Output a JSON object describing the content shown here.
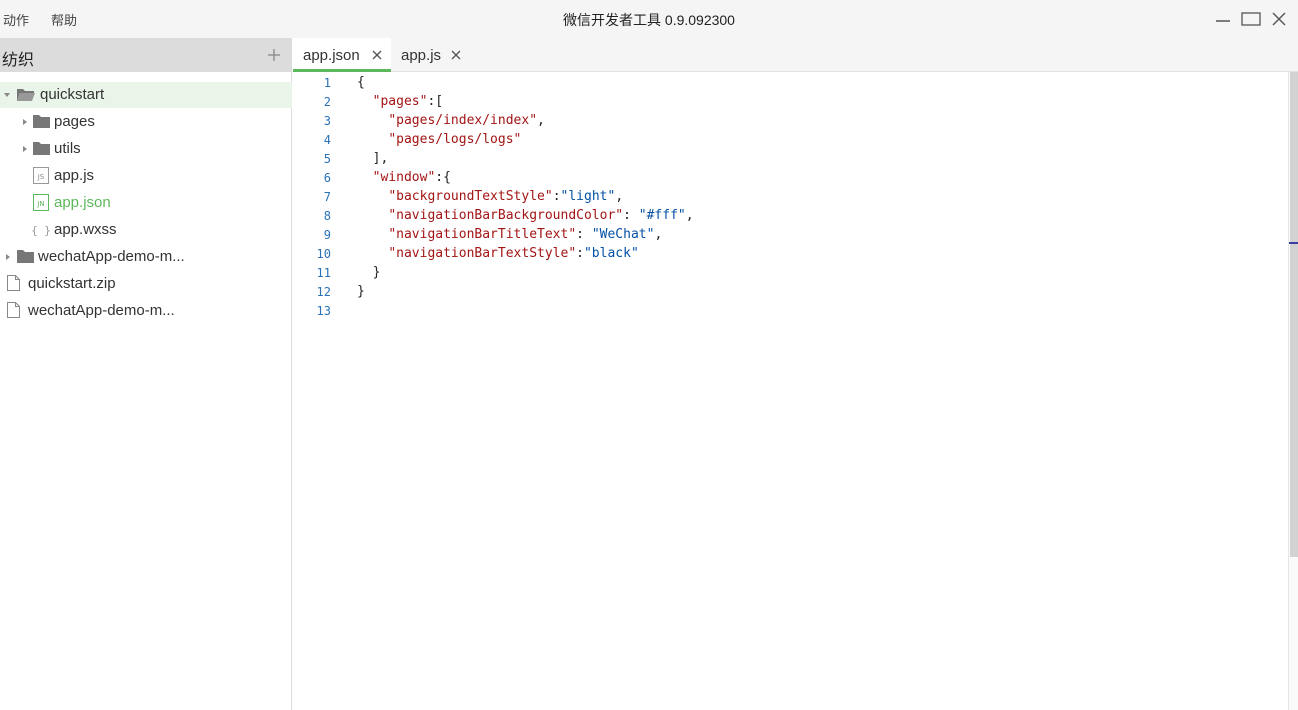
{
  "titlebar": {
    "menus": [
      "动作",
      "帮助"
    ],
    "title": "微信开发者工具 0.9.092300"
  },
  "sidebar": {
    "title": "纺织",
    "items": [
      {
        "label": "quickstart",
        "type": "folder-open",
        "depth": 0,
        "expanded": true,
        "selected": true
      },
      {
        "label": "pages",
        "type": "folder",
        "depth": 1,
        "expanded": false
      },
      {
        "label": "utils",
        "type": "folder",
        "depth": 1,
        "expanded": false
      },
      {
        "label": "app.js",
        "type": "js-file",
        "depth": 1,
        "badge": "JS"
      },
      {
        "label": "app.json",
        "type": "json-file",
        "depth": 1,
        "badge": "JN",
        "active": true
      },
      {
        "label": "app.wxss",
        "type": "wxss-file",
        "depth": 1,
        "badge": "{ }"
      },
      {
        "label": "wechatApp-demo-m...",
        "type": "folder",
        "depth": 0,
        "expanded": false
      },
      {
        "label": "quickstart.zip",
        "type": "file",
        "depth": 0
      },
      {
        "label": "wechatApp-demo-m...",
        "type": "file",
        "depth": 0
      }
    ]
  },
  "tabs": [
    {
      "label": "app.json",
      "active": true
    },
    {
      "label": "app.js",
      "active": false
    }
  ],
  "editor": {
    "line_numbers": [
      "1",
      "2",
      "3",
      "4",
      "5",
      "6",
      "7",
      "8",
      "9",
      "10",
      "11",
      "12",
      "13"
    ],
    "lines": [
      "{",
      "  \"pages\":[",
      "    \"pages/index/index\",",
      "    \"pages/logs/logs\"",
      "  ],",
      "  \"window\":{",
      "    \"backgroundTextStyle\":\"light\",",
      "    \"navigationBarBackgroundColor\": \"#fff\",",
      "    \"navigationBarTitleText\": \"WeChat\",",
      "    \"navigationBarTextStyle\":\"black\"",
      "  }",
      "}",
      ""
    ]
  },
  "colors": {
    "accent": "#5cb85c",
    "line_number": "#2a72b8",
    "json_key": "#a31515",
    "json_value": "#0451a5"
  }
}
